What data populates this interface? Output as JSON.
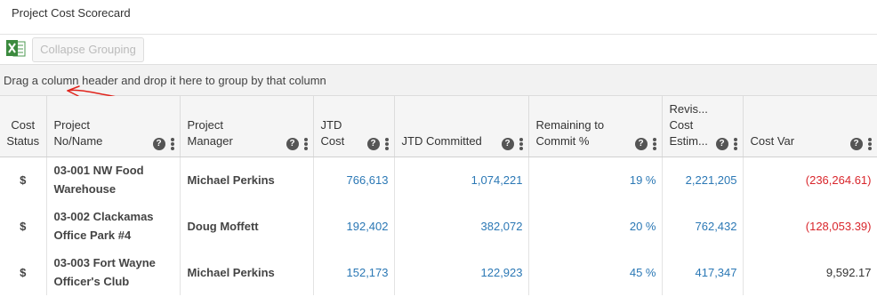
{
  "page": {
    "title": "Project Cost Scorecard"
  },
  "toolbar": {
    "excel_icon": "excel-export-icon",
    "collapse_label": "Collapse Grouping"
  },
  "group_panel": {
    "hint": "Drag a column header and drop it here to group by that column"
  },
  "columns": [
    {
      "label": "Cost Status"
    },
    {
      "label": "Project No/Name"
    },
    {
      "label": "Project Manager"
    },
    {
      "label": "JTD Cost"
    },
    {
      "label": "JTD Committed"
    },
    {
      "label": "Remaining to Commit %"
    },
    {
      "label": "Revis... Cost Estim..."
    },
    {
      "label": "Cost Var"
    }
  ],
  "rows": [
    {
      "status": "$",
      "project": "03-001 NW Food Warehouse",
      "manager": "Michael Perkins",
      "jtd_cost": "766,613",
      "jtd_committed": "1,074,221",
      "remaining_pct": "19 %",
      "revised_estimate": "2,221,205",
      "cost_var": "(236,264.61)"
    },
    {
      "status": "$",
      "project": "03-002 Clackamas Office Park #4",
      "manager": "Doug Moffett",
      "jtd_cost": "192,402",
      "jtd_committed": "382,072",
      "remaining_pct": "20 %",
      "revised_estimate": "762,432",
      "cost_var": "(128,053.39)"
    },
    {
      "status": "$",
      "project": "03-003 Fort Wayne Officer's Club",
      "manager": "Michael Perkins",
      "jtd_cost": "152,173",
      "jtd_committed": "122,923",
      "remaining_pct": "45 %",
      "revised_estimate": "417,347",
      "cost_var": "9,592.17"
    }
  ],
  "colors": {
    "link_blue": "#2b78b5",
    "negative_red": "#d9262c",
    "annotation_red": "#e0231b"
  }
}
